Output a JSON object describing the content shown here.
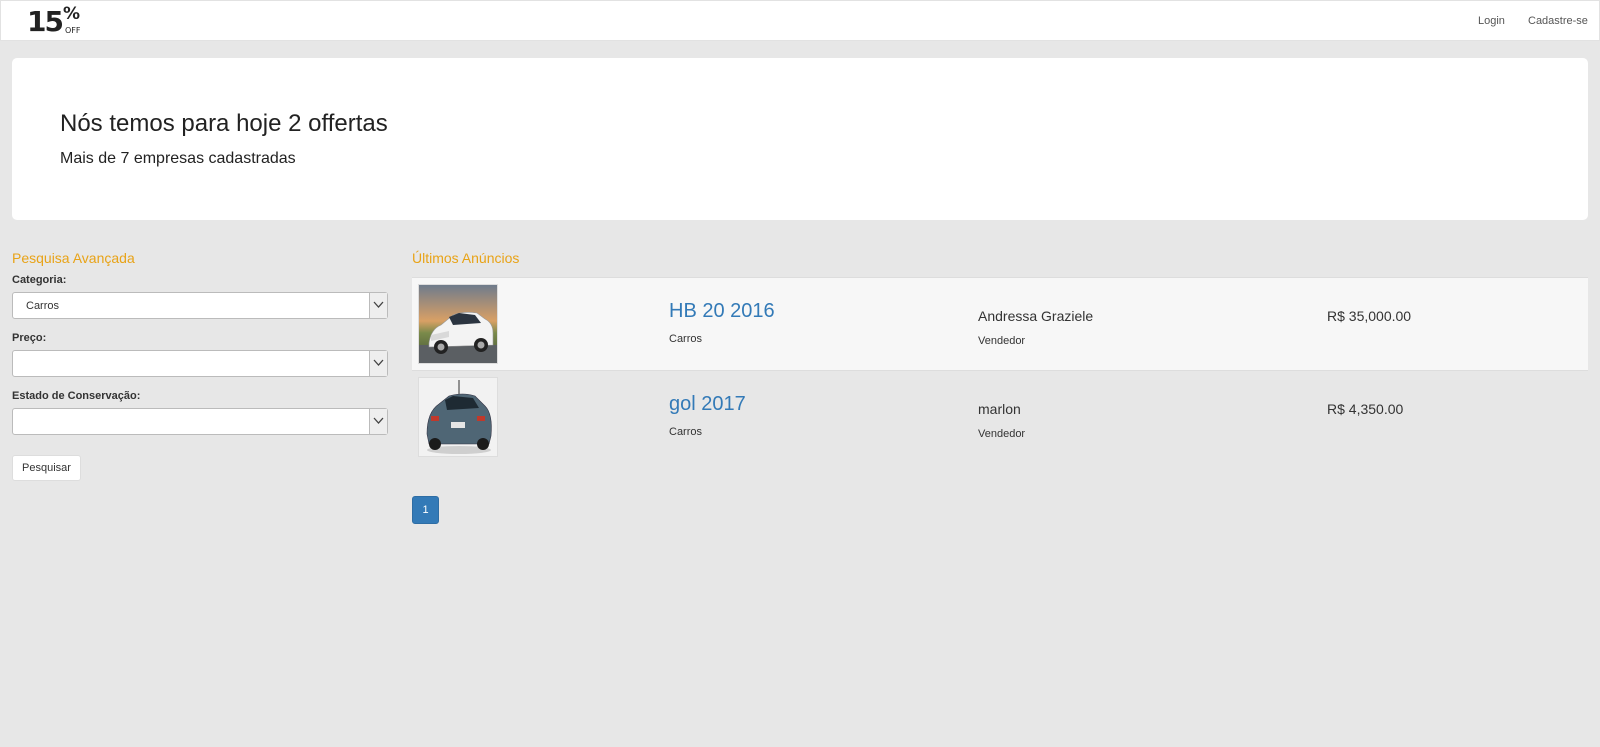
{
  "logo": {
    "number": "15",
    "percent": "%",
    "off": "OFF"
  },
  "nav": {
    "login": "Login",
    "signup": "Cadastre-se"
  },
  "hero": {
    "title": "Nós temos para hoje 2 offertas",
    "subtitle": "Mais de 7 empresas cadastradas"
  },
  "search": {
    "title": "Pesquisa Avançada",
    "category_label": "Categoria:",
    "category_value": "Carros",
    "price_label": "Preço:",
    "price_value": "",
    "condition_label": "Estado de Conservação:",
    "condition_value": "",
    "submit": "Pesquisar"
  },
  "listings": {
    "title": "Últimos Anúncios",
    "items": [
      {
        "title": "HB 20 2016",
        "category": "Carros",
        "seller": "Andressa Graziele",
        "role": "Vendedor",
        "price": "R$ 35,000.00",
        "image": "white-hatchback-photo"
      },
      {
        "title": "gol 2017",
        "category": "Carros",
        "seller": "marlon",
        "role": "Vendedor",
        "price": "R$ 4,350.00",
        "image": "blue-hatchback-photo"
      }
    ]
  },
  "pagination": {
    "current": "1"
  },
  "colors": {
    "accent": "#e8a317",
    "link": "#337ab7",
    "background": "#e7e7e7"
  }
}
